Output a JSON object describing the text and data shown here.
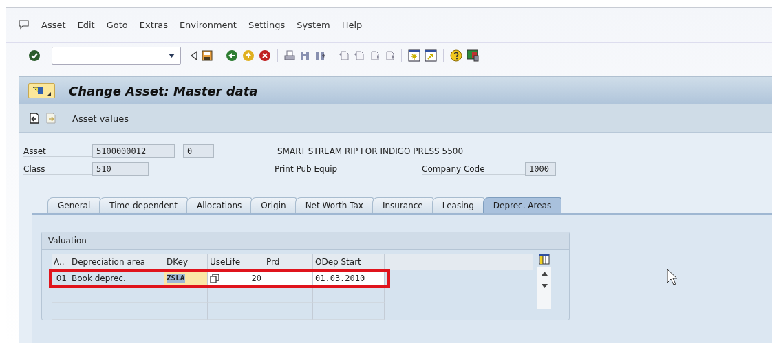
{
  "menu": [
    "Asset",
    "Edit",
    "Goto",
    "Extras",
    "Environment",
    "Settings",
    "System",
    "Help"
  ],
  "title": "Change Asset: Master data",
  "app_toolbar": {
    "label": "Asset values"
  },
  "header": {
    "asset": {
      "label": "Asset",
      "value": "5100000012",
      "sub_number": "0",
      "description": "SMART STREAM RIP FOR INDIGO PRESS 5500"
    },
    "class": {
      "label": "Class",
      "value": "510",
      "description": "Print Pub Equip"
    },
    "company_code": {
      "label": "Company Code",
      "value": "1000"
    }
  },
  "tabs": [
    {
      "label": "General",
      "selected": false
    },
    {
      "label": "Time-dependent",
      "selected": false
    },
    {
      "label": "Allocations",
      "selected": false
    },
    {
      "label": "Origin",
      "selected": false
    },
    {
      "label": "Net Worth Tax",
      "selected": false
    },
    {
      "label": "Insurance",
      "selected": false
    },
    {
      "label": "Leasing",
      "selected": false
    },
    {
      "label": "Deprec. Areas",
      "selected": true
    }
  ],
  "valuation": {
    "title": "Valuation",
    "columns": [
      "A..",
      "Depreciation area",
      "DKey",
      "UseLife",
      "Prd",
      "ODep Start"
    ],
    "rows": [
      {
        "area_no": "01",
        "area": "Book deprec.",
        "dkey": "ZSLA",
        "dkey_selected": true,
        "use_life": "20",
        "period": "",
        "odep_start": "01.03.2010",
        "highlighted": true
      }
    ]
  }
}
